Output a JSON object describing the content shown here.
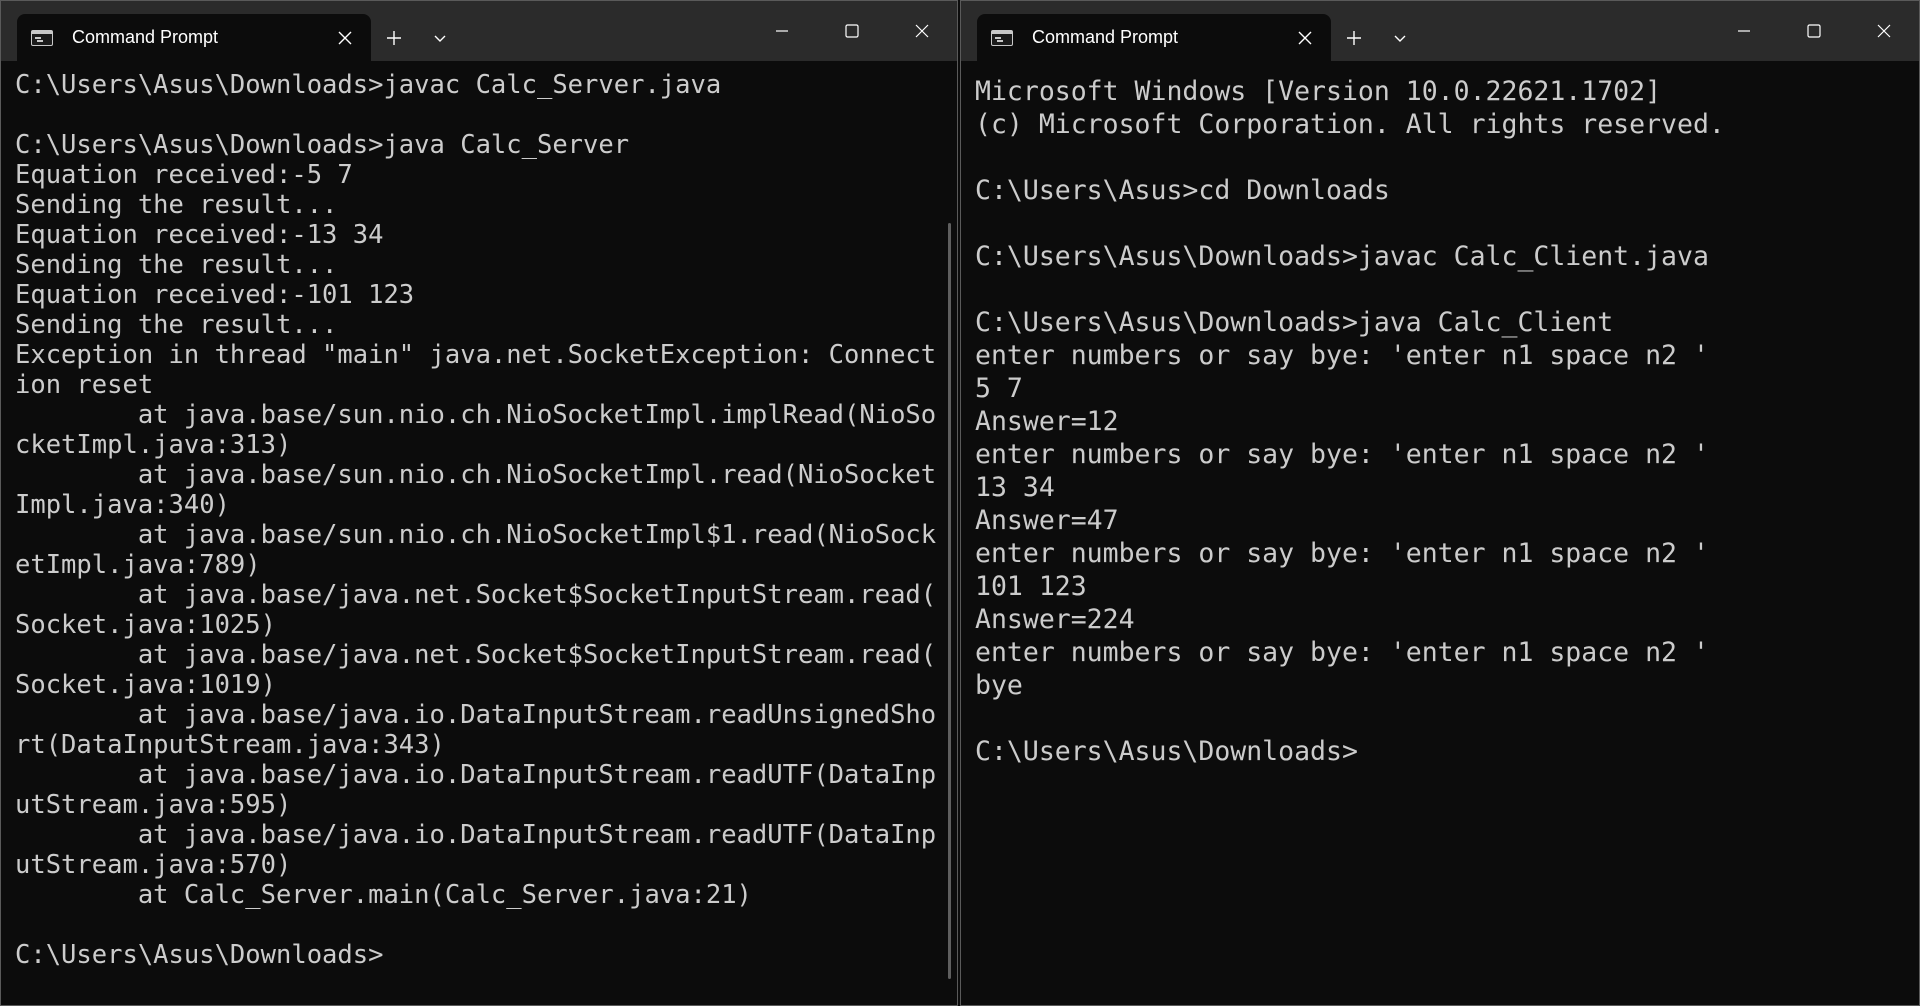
{
  "left_window": {
    "tab_title": "Command Prompt",
    "lines": [
      "C:\\Users\\Asus\\Downloads>javac Calc_Server.java",
      "",
      "C:\\Users\\Asus\\Downloads>java Calc_Server",
      "Equation received:-5 7",
      "Sending the result...",
      "Equation received:-13 34",
      "Sending the result...",
      "Equation received:-101 123",
      "Sending the result...",
      "Exception in thread \"main\" java.net.SocketException: Connect",
      "ion reset",
      "        at java.base/sun.nio.ch.NioSocketImpl.implRead(NioSo",
      "cketImpl.java:313)",
      "        at java.base/sun.nio.ch.NioSocketImpl.read(NioSocket",
      "Impl.java:340)",
      "        at java.base/sun.nio.ch.NioSocketImpl$1.read(NioSock",
      "etImpl.java:789)",
      "        at java.base/java.net.Socket$SocketInputStream.read(",
      "Socket.java:1025)",
      "        at java.base/java.net.Socket$SocketInputStream.read(",
      "Socket.java:1019)",
      "        at java.base/java.io.DataInputStream.readUnsignedSho",
      "rt(DataInputStream.java:343)",
      "        at java.base/java.io.DataInputStream.readUTF(DataInp",
      "utStream.java:595)",
      "        at java.base/java.io.DataInputStream.readUTF(DataInp",
      "utStream.java:570)",
      "        at Calc_Server.main(Calc_Server.java:21)",
      "",
      "C:\\Users\\Asus\\Downloads>"
    ]
  },
  "right_window": {
    "tab_title": "Command Prompt",
    "lines": [
      "Microsoft Windows [Version 10.0.22621.1702]",
      "(c) Microsoft Corporation. All rights reserved.",
      "",
      "C:\\Users\\Asus>cd Downloads",
      "",
      "C:\\Users\\Asus\\Downloads>javac Calc_Client.java",
      "",
      "C:\\Users\\Asus\\Downloads>java Calc_Client",
      "enter numbers or say bye: 'enter n1 space n2 '",
      "5 7",
      "Answer=12",
      "enter numbers or say bye: 'enter n1 space n2 '",
      "13 34",
      "Answer=47",
      "enter numbers or say bye: 'enter n1 space n2 '",
      "101 123",
      "Answer=224",
      "enter numbers or say bye: 'enter n1 space n2 '",
      "bye",
      "",
      "C:\\Users\\Asus\\Downloads>"
    ]
  },
  "icons": {
    "tab_icon": "terminal-icon",
    "close_tab": "close-icon",
    "new_tab": "plus-icon",
    "dropdown": "chevron-down-icon",
    "minimize": "minimize-icon",
    "maximize": "maximize-icon",
    "close_window": "close-icon"
  },
  "colors": {
    "titlebar": "#2b2b2b",
    "console_bg": "#0c0c0c",
    "console_text": "#cccccc"
  }
}
